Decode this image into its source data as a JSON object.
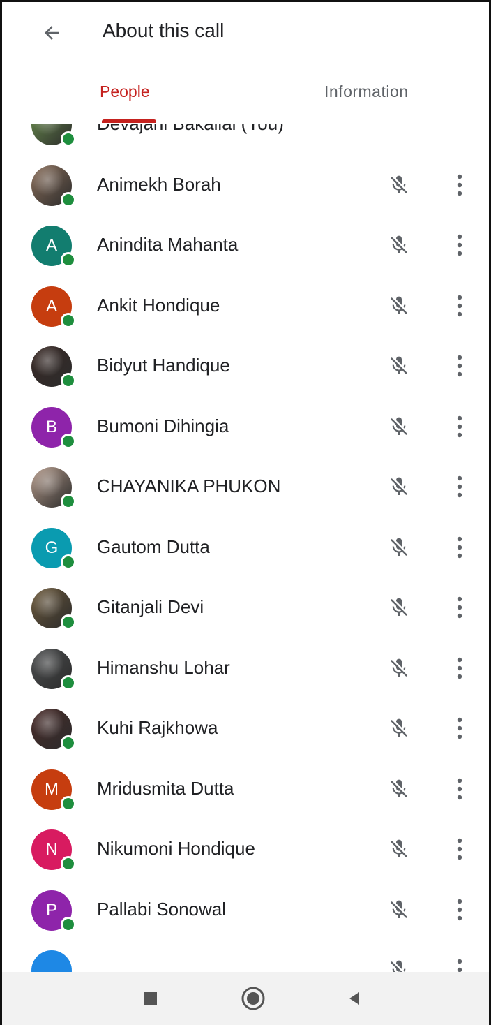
{
  "header": {
    "title": "About this call",
    "back_icon": "arrow-left-icon"
  },
  "tabs": [
    {
      "label": "People",
      "active": true
    },
    {
      "label": "Information",
      "active": false
    }
  ],
  "colors": {
    "accent": "#c5221f",
    "presence": "#1e8e3e",
    "muted_icon": "#5f6368"
  },
  "participants": [
    {
      "name": "Devajani Bakalial (You)",
      "avatar": "photo",
      "initial": "",
      "color": "#6b8f4e",
      "muted": false
    },
    {
      "name": "Animekh Borah",
      "avatar": "photo",
      "initial": "",
      "color": "#8a6e5a",
      "muted": true
    },
    {
      "name": "Anindita Mahanta",
      "avatar": "letter",
      "initial": "A",
      "color": "#127d6f",
      "muted": true
    },
    {
      "name": "Ankit Hondique",
      "avatar": "letter",
      "initial": "A",
      "color": "#c63d0f",
      "muted": true
    },
    {
      "name": "Bidyut Handique",
      "avatar": "photo",
      "initial": "",
      "color": "#3a2a26",
      "muted": true
    },
    {
      "name": "Bumoni Dihingia",
      "avatar": "letter",
      "initial": "B",
      "color": "#8e24aa",
      "muted": true
    },
    {
      "name": "CHAYANIKA PHUKON",
      "avatar": "photo",
      "initial": "",
      "color": "#b49a8a",
      "muted": true
    },
    {
      "name": "Gautom Dutta",
      "avatar": "letter",
      "initial": "G",
      "color": "#0a9bb0",
      "muted": true
    },
    {
      "name": "Gitanjali Devi",
      "avatar": "photo",
      "initial": "",
      "color": "#6d5a3c",
      "muted": true
    },
    {
      "name": "Himanshu Lohar",
      "avatar": "photo",
      "initial": "",
      "color": "#4d4f50",
      "muted": true
    },
    {
      "name": "Kuhi Rajkhowa",
      "avatar": "photo",
      "initial": "",
      "color": "#4a2c2a",
      "muted": true
    },
    {
      "name": "Mridusmita Dutta",
      "avatar": "letter",
      "initial": "M",
      "color": "#c63d0f",
      "muted": true
    },
    {
      "name": "Nikumoni Hondique",
      "avatar": "letter",
      "initial": "N",
      "color": "#d81b60",
      "muted": true
    },
    {
      "name": "Pallabi Sonowal",
      "avatar": "letter",
      "initial": "P",
      "color": "#8e24aa",
      "muted": true
    },
    {
      "name": "",
      "avatar": "letter",
      "initial": "",
      "color": "#1e88e5",
      "muted": true
    }
  ],
  "navbar": {
    "icons": [
      "square-recents-icon",
      "circle-home-icon",
      "triangle-back-icon"
    ]
  }
}
